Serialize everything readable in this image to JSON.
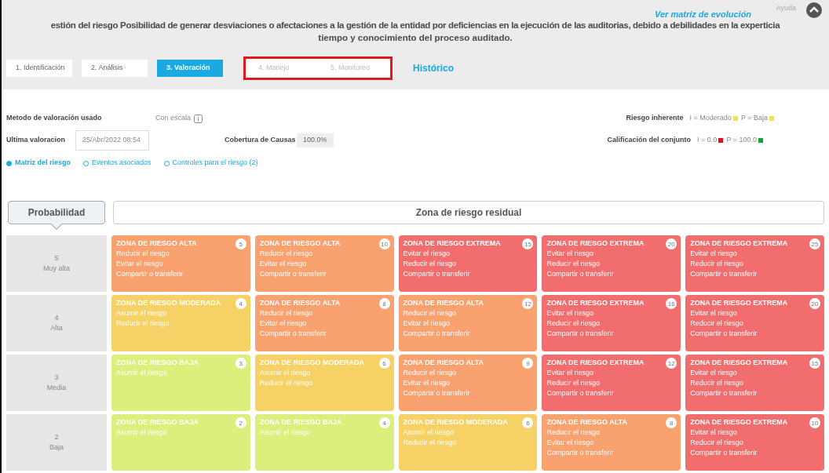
{
  "header": {
    "help": "Ayuda",
    "link": "Ver matriz de evolución",
    "title_lines": [
      "estión del riesgo Posibilidad de generar desviaciones o afectaciones a la gestión de la entidad por deficiencias en la ejecución de las auditorias, debido a debilidades en la experticia",
      "tiempo y conocimiento del proceso auditado."
    ]
  },
  "steps": [
    {
      "label": "1. Identificación",
      "selected": false,
      "disabled": false,
      "highlighted": false
    },
    {
      "label": "2. Análisis",
      "selected": false,
      "disabled": false,
      "highlighted": false
    },
    {
      "label": "3. Valoración",
      "selected": true,
      "disabled": false,
      "highlighted": false
    },
    {
      "label": "4. Manejo",
      "selected": false,
      "disabled": true,
      "highlighted": true
    },
    {
      "label": "5. Monitoreo",
      "selected": false,
      "disabled": true,
      "highlighted": true
    }
  ],
  "history_link": "Histórico",
  "info": {
    "method_label": "Metodo de valoración usado",
    "method_value": "Con escala",
    "last_label": "Ultima valoracion",
    "last_value": "25/Abr/2022 08:54",
    "coverage_label": "Cobertura de Causas",
    "coverage_value": "100.0%",
    "inherent_label": "Riesgo inherente",
    "inherent": [
      {
        "text": "I = Moderado",
        "color": "#f5e14a"
      },
      {
        "text": "P = Baja",
        "color": "#f5e14a"
      }
    ],
    "overall_label": "Calificación del conjunto",
    "overall": [
      {
        "text": "I = 0.0",
        "color": "#e0101a"
      },
      {
        "text": "P = 100.0",
        "color": "#17a334"
      }
    ]
  },
  "view_tabs": [
    {
      "label": "Matriz del riesgo",
      "selected": true
    },
    {
      "label": "Eventos asociados",
      "selected": false
    },
    {
      "label": "Controles para el riesgo (2)",
      "selected": false
    }
  ],
  "matrix": {
    "row_header": "Probabilidad",
    "column_header": "Zona de riesgo residual",
    "rows": [
      {
        "level": "5",
        "name": "Muy alta",
        "cells": [
          {
            "kind": "alta",
            "zone": "ZONA DE RIESGO ALTA",
            "score": "5",
            "actions": [
              "Reducir el riesgo",
              "Evitar el riesgo",
              "Compartir o transferir"
            ]
          },
          {
            "kind": "alta",
            "zone": "ZONA DE RIESGO ALTA",
            "score": "10",
            "actions": [
              "Reducir el riesgo",
              "Evitar el riesgo",
              "Compartir o transferir"
            ]
          },
          {
            "kind": "extrema",
            "zone": "ZONA DE RIESGO EXTREMA",
            "score": "15",
            "actions": [
              "Evitar el riesgo",
              "Reducir el riesgo",
              "Compartir o transferir"
            ]
          },
          {
            "kind": "extrema",
            "zone": "ZONA DE RIESGO EXTREMA",
            "score": "20",
            "actions": [
              "Evitar el riesgo",
              "Reducir el riesgo",
              "Compartir o transferir"
            ]
          },
          {
            "kind": "extrema",
            "zone": "ZONA DE RIESGO EXTREMA",
            "score": "25",
            "actions": [
              "Evitar el riesgo",
              "Reducir el riesgo",
              "Compartir o transferir"
            ]
          }
        ]
      },
      {
        "level": "4",
        "name": "Alta",
        "cells": [
          {
            "kind": "moderada",
            "zone": "ZONA DE RIESGO MODERADA",
            "score": "4",
            "actions": [
              "Asumir el riesgo",
              "Reducir el riesgo"
            ]
          },
          {
            "kind": "alta",
            "zone": "ZONA DE RIESGO ALTA",
            "score": "8",
            "actions": [
              "Reducir el riesgo",
              "Evitar el riesgo",
              "Compartir o transferir"
            ]
          },
          {
            "kind": "alta",
            "zone": "ZONA DE RIESGO ALTA",
            "score": "12",
            "actions": [
              "Reducir el riesgo",
              "Evitar el riesgo",
              "Compartir o transferir"
            ]
          },
          {
            "kind": "extrema",
            "zone": "ZONA DE RIESGO EXTREMA",
            "score": "16",
            "actions": [
              "Evitar el riesgo",
              "Reducir el riesgo",
              "Compartir o transferir"
            ]
          },
          {
            "kind": "extrema",
            "zone": "ZONA DE RIESGO EXTREMA",
            "score": "20",
            "actions": [
              "Evitar el riesgo",
              "Reducir el riesgo",
              "Compartir o transferir"
            ]
          }
        ]
      },
      {
        "level": "3",
        "name": "Media",
        "cells": [
          {
            "kind": "baja",
            "zone": "ZONA DE RIESGO BAJA",
            "score": "3",
            "actions": [
              "Asumir el riesgo"
            ]
          },
          {
            "kind": "moderada",
            "zone": "ZONA DE RIESGO MODERADA",
            "score": "6",
            "actions": [
              "Asumir el riesgo",
              "Reducir el riesgo"
            ]
          },
          {
            "kind": "alta",
            "zone": "ZONA DE RIESGO ALTA",
            "score": "9",
            "actions": [
              "Reducir el riesgo",
              "Evitar el riesgo",
              "Compartir o transferir"
            ]
          },
          {
            "kind": "extrema",
            "zone": "ZONA DE RIESGO EXTREMA",
            "score": "12",
            "actions": [
              "Evitar el riesgo",
              "Reducir el riesgo",
              "Compartir o transferir"
            ]
          },
          {
            "kind": "extrema",
            "zone": "ZONA DE RIESGO EXTREMA",
            "score": "15",
            "actions": [
              "Evitar el riesgo",
              "Reducir el riesgo",
              "Compartir o transferir"
            ]
          }
        ]
      },
      {
        "level": "2",
        "name": "Baja",
        "cells": [
          {
            "kind": "baja",
            "zone": "ZONA DE RIESGO BAJA",
            "score": "2",
            "actions": [
              "Asumir el riesgo"
            ]
          },
          {
            "kind": "baja",
            "zone": "ZONA DE RIESGO BAJA",
            "score": "4",
            "actions": [
              "Asumir el riesgo"
            ]
          },
          {
            "kind": "moderada",
            "zone": "ZONA DE RIESGO MODERADA",
            "score": "6",
            "actions": [
              "Asumir el riesgo",
              "Reducir el riesgo"
            ]
          },
          {
            "kind": "alta",
            "zone": "ZONA DE RIESGO ALTA",
            "score": "8",
            "actions": [
              "Reducir el riesgo",
              "Evitar el riesgo",
              "Compartir o transferir"
            ]
          },
          {
            "kind": "extrema",
            "zone": "ZONA DE RIESGO EXTREMA",
            "score": "10",
            "actions": [
              "Evitar el riesgo",
              "Reducir el riesgo",
              "Compartir o transferir"
            ]
          }
        ]
      }
    ]
  }
}
